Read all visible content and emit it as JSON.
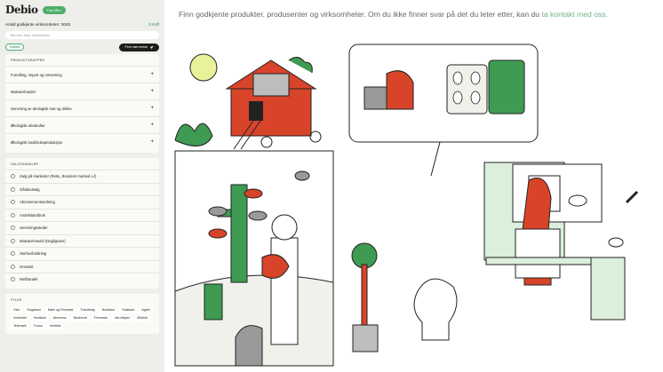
{
  "app": {
    "logo_text": "Debio",
    "badge": "Finn Øko",
    "count_label": "Antall godkjente virksomheter: 3045",
    "count_right": "0 treff"
  },
  "search": {
    "placeholder": "Søk etter foket. bedriftsnavn"
  },
  "filter_chip": "Nullstill",
  "near_button": "Finn nærmeste",
  "product_panel": {
    "title": "PRODUKTGRUPPER",
    "items": [
      "Foredling, import og omsetning",
      "Matvarehandel",
      "Servering av økologisk mat og drikke",
      "Økologisk akvakultur",
      "Økologisk landbruksproduksjon"
    ]
  },
  "sales_panel": {
    "title": "SALGSKANALER",
    "items": [
      "Salg på markeder (Reko, Bondens marked o.l)",
      "Gårdsutsalg",
      "Abonnementsordning",
      "Andelslandbruk",
      "Serveringssteder",
      "Matvarehandel (Dagligvare)",
      "Storhusholdning",
      "Grossist",
      "Netthandel"
    ]
  },
  "county_panel": {
    "title": "FYLKE",
    "items": [
      "Oslo",
      "Rogaland",
      "Møre og Romsdal",
      "Trøndelag",
      "Nordland",
      "Svalbard",
      "Agder",
      "Innlandet",
      "Vestland",
      "Akershus",
      "Buskerud",
      "Finnmark",
      "Jan Mayen",
      "Østfold",
      "Telemark",
      "Troms",
      "Vestfold"
    ]
  },
  "main": {
    "intro_text": "Finn godkjente produkter, produsenter og virksomheter. Om du ikke finner svar på det du leter etter, kan du ",
    "intro_link": "ta kontakt med oss."
  },
  "colors": {
    "accent_green": "#4caf6a",
    "illustration_red": "#d8442a",
    "illustration_green": "#3f9a52",
    "sidebar_bg": "#eeeeea"
  },
  "icons": [
    "locate-arrow-icon",
    "plus-icon",
    "radio-icon"
  ]
}
